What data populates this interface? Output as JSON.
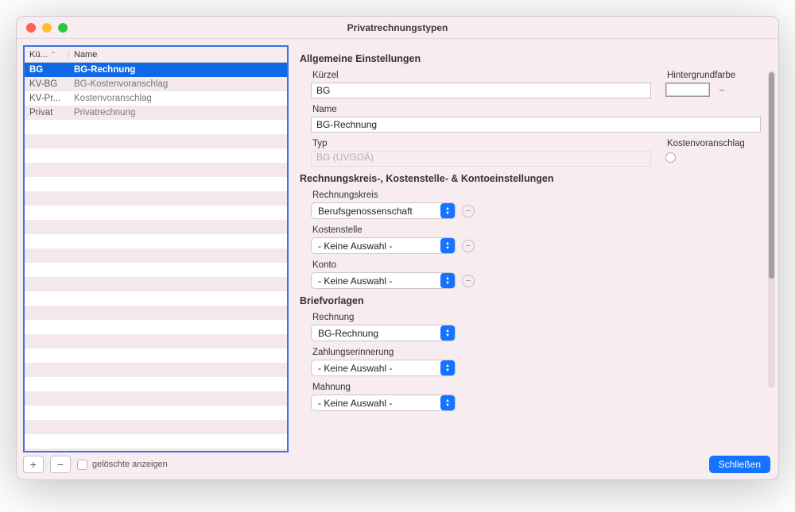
{
  "window": {
    "title": "Privatrechnungstypen"
  },
  "table": {
    "headers": {
      "kurzel": "Kü...",
      "name": "Name"
    },
    "rows": [
      {
        "kurzel": "BG",
        "name": "BG-Rechnung",
        "selected": true
      },
      {
        "kurzel": "KV-BG",
        "name": "BG-Kostenvoranschlag",
        "selected": false
      },
      {
        "kurzel": "KV-Pr...",
        "name": "Kostenvoranschlag",
        "selected": false
      },
      {
        "kurzel": "Privat",
        "name": "Privatrechnung",
        "selected": false
      }
    ],
    "footer": {
      "add": "+",
      "remove": "−",
      "show_deleted": "gelöschte anzeigen"
    }
  },
  "general": {
    "heading": "Allgemeine Einstellungen",
    "kurzel_label": "Kürzel",
    "kurzel_value": "BG",
    "bgcolor_label": "Hintergrundfarbe",
    "name_label": "Name",
    "name_value": "BG-Rechnung",
    "typ_label": "Typ",
    "typ_value": "BG (UVGOÄ)",
    "kostenvoranschlag_label": "Kostenvoranschlag"
  },
  "billing": {
    "heading": "Rechnungskreis-, Kostenstelle- & Kontoeinstellungen",
    "rechnungskreis_label": "Rechnungskreis",
    "rechnungskreis_value": "Berufsgenossenschaft",
    "kostenstelle_label": "Kostenstelle",
    "kostenstelle_value": "- Keine Auswahl -",
    "konto_label": "Konto",
    "konto_value": "- Keine Auswahl -"
  },
  "templates": {
    "heading": "Briefvorlagen",
    "rechnung_label": "Rechnung",
    "rechnung_value": "BG-Rechnung",
    "zahlungserinnerung_label": "Zahlungserinnerung",
    "zahlungserinnerung_value": "- Keine Auswahl -",
    "mahnung_label": "Mahnung",
    "mahnung_value": "- Keine Auswahl -"
  },
  "footer": {
    "close": "Schließen"
  }
}
